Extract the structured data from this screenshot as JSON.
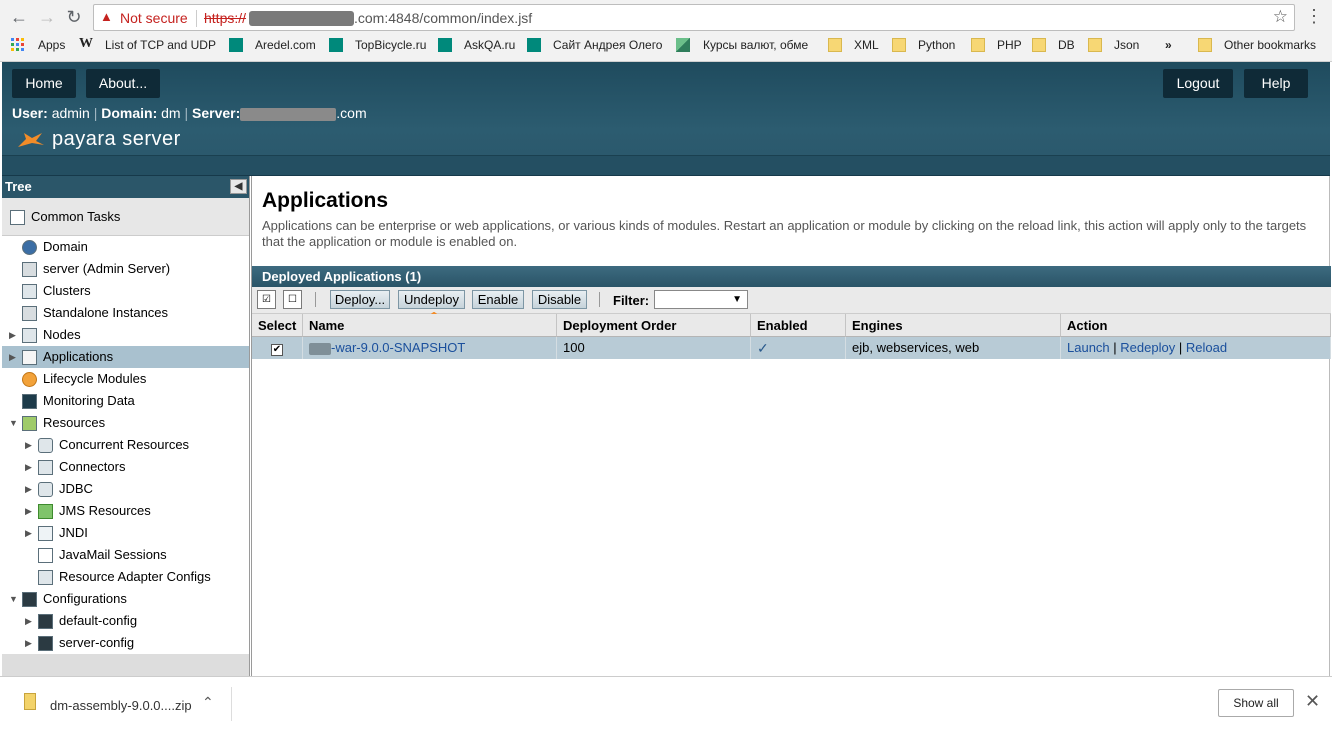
{
  "browser": {
    "security_label": "Not secure",
    "url_scheme": "https://",
    "url_rest": ".com:4848/common/index.jsf",
    "bookmarks": [
      {
        "label": "Apps"
      },
      {
        "label": "List of TCP and UDP"
      },
      {
        "label": "Aredel.com"
      },
      {
        "label": "TopBicycle.ru"
      },
      {
        "label": "AskQA.ru"
      },
      {
        "label": "Сайт Андрея Олего"
      },
      {
        "label": "Курсы валют, обме"
      },
      {
        "label": "XML"
      },
      {
        "label": "Python"
      },
      {
        "label": "PHP"
      },
      {
        "label": "DB"
      },
      {
        "label": "Json"
      },
      {
        "label": "»"
      },
      {
        "label": "Other bookmarks"
      }
    ]
  },
  "header": {
    "home": "Home",
    "about": "About...",
    "logout": "Logout",
    "help": "Help",
    "user_prefix": "User:",
    "user": "admin",
    "domain_prefix": "Domain:",
    "domain": "dm",
    "server_prefix": "Server:",
    "server_suffix": ".com",
    "logo_text": "payara server"
  },
  "tree": {
    "title": "Tree",
    "common_tasks": "Common Tasks",
    "items": [
      {
        "label": "Domain"
      },
      {
        "label": "server (Admin Server)"
      },
      {
        "label": "Clusters"
      },
      {
        "label": "Standalone Instances"
      },
      {
        "label": "Nodes"
      },
      {
        "label": "Applications"
      },
      {
        "label": "Lifecycle Modules"
      },
      {
        "label": "Monitoring Data"
      },
      {
        "label": "Resources"
      },
      {
        "label": "Concurrent Resources"
      },
      {
        "label": "Connectors"
      },
      {
        "label": "JDBC"
      },
      {
        "label": "JMS Resources"
      },
      {
        "label": "JNDI"
      },
      {
        "label": "JavaMail Sessions"
      },
      {
        "label": "Resource Adapter Configs"
      },
      {
        "label": "Configurations"
      },
      {
        "label": "default-config"
      },
      {
        "label": "server-config"
      }
    ]
  },
  "main": {
    "title": "Applications",
    "description": "Applications can be enterprise or web applications, or various kinds of modules. Restart an application or module by clicking on the reload link, this action will apply only to the targets that the application or module is enabled on.",
    "table_title": "Deployed Applications (1)",
    "toolbar": {
      "deploy": "Deploy...",
      "undeploy": "Undeploy",
      "enable": "Enable",
      "disable": "Disable",
      "filter_label": "Filter:",
      "filter_value": ""
    },
    "columns": [
      "Select",
      "Name",
      "Deployment Order",
      "Enabled",
      "Engines",
      "Action"
    ],
    "rows": [
      {
        "selected": true,
        "name": "-war-9.0.0-SNAPSHOT",
        "order": "100",
        "enabled": true,
        "engines": "ejb, webservices, web",
        "actions": [
          "Launch",
          "Redeploy",
          "Reload"
        ]
      }
    ]
  },
  "downloads": {
    "file": "dm-assembly-9.0.0....zip",
    "show_all": "Show all"
  },
  "colors": {
    "header_bg": "#2c5c70",
    "accent_orange": "#f28c28",
    "link_blue": "#1a4f9c",
    "selected_row": "#b8cbd6"
  }
}
